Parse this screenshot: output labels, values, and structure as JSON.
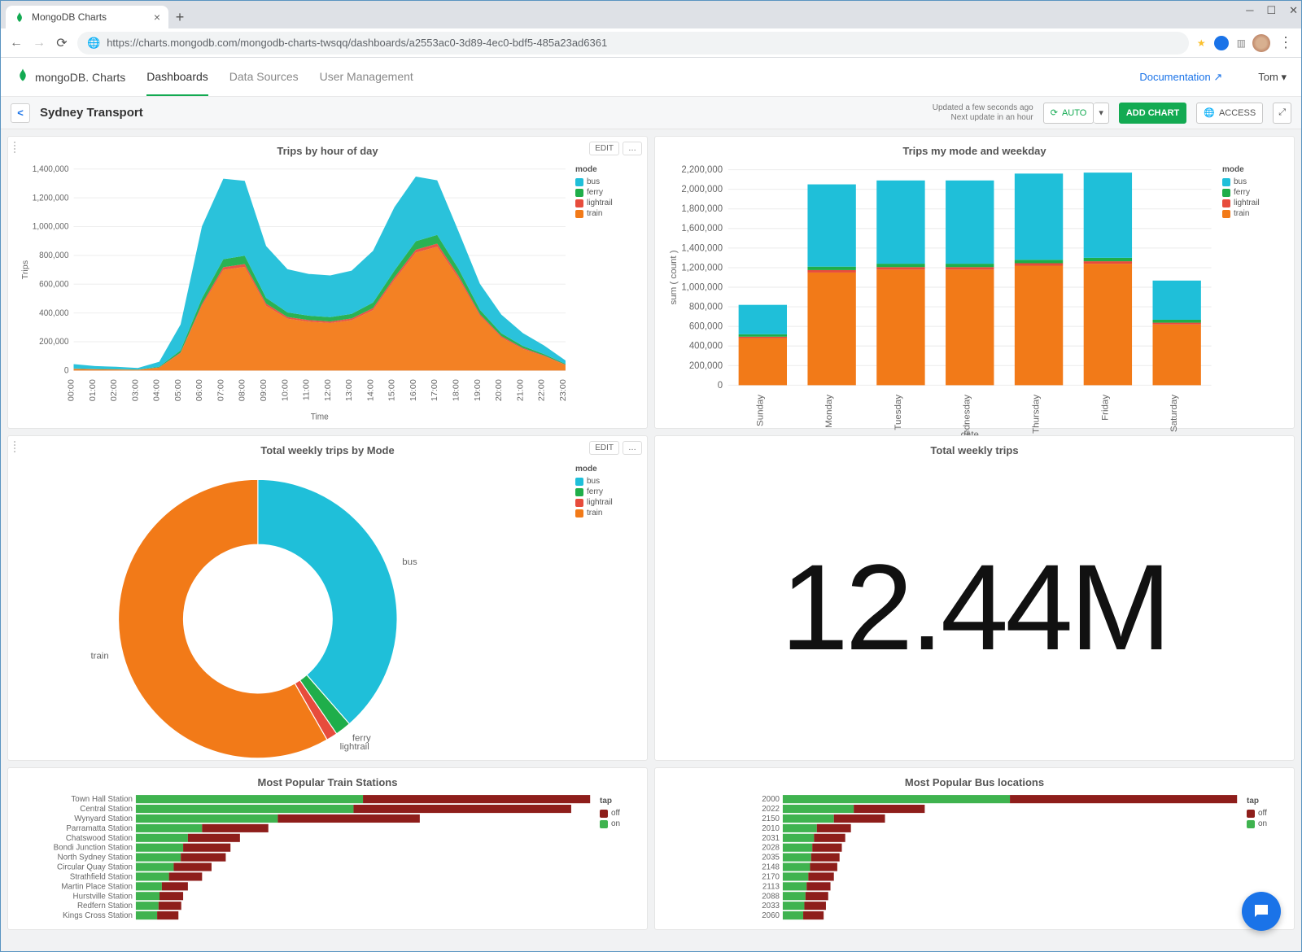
{
  "browser": {
    "tab_title": "MongoDB Charts",
    "url": "https://charts.mongodb.com/mongodb-charts-twsqq/dashboards/a2553ac0-3d89-4ec0-bdf5-485a23ad6361"
  },
  "appbar": {
    "brand_main": "mongoDB",
    "brand_sub": "Charts",
    "nav": {
      "dashboards": "Dashboards",
      "datasources": "Data Sources",
      "usermgmt": "User Management"
    },
    "documentation": "Documentation",
    "user": "Tom"
  },
  "dashbar": {
    "title": "Sydney Transport",
    "status1": "Updated a few seconds ago",
    "status2": "Next update in an hour",
    "auto": "AUTO",
    "add": "ADD CHART",
    "access": "ACCESS"
  },
  "cards": {
    "area": {
      "title": "Trips by hour of day",
      "edit": "EDIT",
      "xlabel": "Time",
      "ylabel": "Trips"
    },
    "bars": {
      "title": "Trips my mode and weekday",
      "xlabel": "date",
      "ylabel": "sum ( count )"
    },
    "donut": {
      "title": "Total weekly trips by Mode",
      "edit": "EDIT"
    },
    "kpi": {
      "title": "Total weekly trips",
      "value": "12.44M"
    },
    "train": {
      "title": "Most Popular Train Stations"
    },
    "buses": {
      "title": "Most Popular Bus locations"
    }
  },
  "legend": {
    "mode": "mode",
    "bus": "bus",
    "ferry": "ferry",
    "light": "lightrail",
    "train": "train",
    "tap": "tap",
    "off": "off",
    "on": "on"
  },
  "chart_data": [
    {
      "id": "trips_by_hour",
      "type": "area",
      "title": "Trips by hour of day",
      "xlabel": "Time",
      "ylabel": "Trips",
      "x": [
        "00:00",
        "01:00",
        "02:00",
        "03:00",
        "04:00",
        "05:00",
        "06:00",
        "07:00",
        "08:00",
        "09:00",
        "10:00",
        "11:00",
        "12:00",
        "13:00",
        "14:00",
        "15:00",
        "16:00",
        "17:00",
        "18:00",
        "19:00",
        "20:00",
        "21:00",
        "22:00",
        "23:00"
      ],
      "ylim": [
        0,
        1400000
      ],
      "series": [
        {
          "name": "train",
          "color": "#f27a18",
          "values": [
            10000,
            8000,
            7000,
            5000,
            20000,
            120000,
            450000,
            700000,
            720000,
            450000,
            360000,
            340000,
            330000,
            350000,
            420000,
            630000,
            820000,
            860000,
            640000,
            380000,
            230000,
            150000,
            100000,
            38000
          ]
        },
        {
          "name": "lightrail",
          "color": "#e74c3c",
          "values": [
            2000,
            1500,
            1200,
            1000,
            2000,
            5000,
            12000,
            18000,
            20000,
            15000,
            12000,
            11000,
            11000,
            12000,
            14000,
            17000,
            20000,
            22000,
            18000,
            12000,
            9000,
            7000,
            5000,
            3000
          ]
        },
        {
          "name": "ferry",
          "color": "#1fae4a",
          "values": [
            3000,
            2000,
            2000,
            1500,
            4000,
            15000,
            40000,
            55000,
            58000,
            40000,
            32000,
            30000,
            30000,
            32000,
            38000,
            48000,
            58000,
            60000,
            48000,
            30000,
            20000,
            14000,
            9000,
            5000
          ]
        },
        {
          "name": "bus",
          "color": "#1fbfd9",
          "values": [
            30000,
            20000,
            16000,
            10000,
            35000,
            180000,
            500000,
            560000,
            520000,
            360000,
            300000,
            290000,
            290000,
            300000,
            360000,
            440000,
            450000,
            380000,
            260000,
            180000,
            130000,
            90000,
            60000,
            24000
          ]
        }
      ]
    },
    {
      "id": "trips_by_weekday",
      "type": "bar",
      "stacked": true,
      "title": "Trips my mode and weekday",
      "xlabel": "date",
      "ylabel": "sum ( count )",
      "categories": [
        "Sunday",
        "Monday",
        "Tuesday",
        "Wednesday",
        "Thursday",
        "Friday",
        "Saturday"
      ],
      "ylim": [
        0,
        2200000
      ],
      "series": [
        {
          "name": "train",
          "color": "#f27a18",
          "values": [
            480000,
            1150000,
            1180000,
            1180000,
            1220000,
            1240000,
            620000
          ]
        },
        {
          "name": "lightrail",
          "color": "#e74c3c",
          "values": [
            15000,
            25000,
            25000,
            25000,
            25000,
            25000,
            18000
          ]
        },
        {
          "name": "ferry",
          "color": "#1fae4a",
          "values": [
            25000,
            35000,
            35000,
            35000,
            35000,
            35000,
            30000
          ]
        },
        {
          "name": "bus",
          "color": "#1fbfd9",
          "values": [
            300000,
            840000,
            850000,
            850000,
            880000,
            870000,
            400000
          ]
        }
      ]
    },
    {
      "id": "weekly_by_mode",
      "type": "pie",
      "title": "Total weekly trips by Mode",
      "slices": [
        {
          "name": "bus",
          "color": "#1fbfd9",
          "value": 4800000
        },
        {
          "name": "ferry",
          "color": "#1fae4a",
          "value": 230000
        },
        {
          "name": "lightrail",
          "color": "#e74c3c",
          "value": 160000
        },
        {
          "name": "train",
          "color": "#f27a18",
          "value": 7250000
        }
      ]
    },
    {
      "id": "weekly_total",
      "type": "number",
      "title": "Total weekly trips",
      "value": "12.44M"
    },
    {
      "id": "train_stations",
      "type": "bar",
      "orientation": "h",
      "stacked": true,
      "title": "Most Popular Train Stations",
      "categories": [
        "Town Hall Station",
        "Central Station",
        "Wynyard Station",
        "Parramatta Station",
        "Chatswood Station",
        "Bondi Junction Station",
        "North Sydney Station",
        "Circular Quay Station",
        "Strathfield Station",
        "Martin Place Station",
        "Hurstville Station",
        "Redfern Station",
        "Kings Cross Station"
      ],
      "series": [
        {
          "name": "on",
          "color": "#3fb34f",
          "values": [
            480,
            460,
            300,
            140,
            110,
            100,
            95,
            80,
            70,
            55,
            50,
            48,
            45
          ]
        },
        {
          "name": "off",
          "color": "#8e1e1b",
          "values": [
            480,
            460,
            300,
            140,
            110,
            100,
            95,
            80,
            70,
            55,
            50,
            48,
            45
          ]
        }
      ]
    },
    {
      "id": "bus_locations",
      "type": "bar",
      "orientation": "h",
      "stacked": true,
      "title": "Most Popular Bus locations",
      "categories": [
        "2000",
        "2022",
        "2150",
        "2010",
        "2031",
        "2028",
        "2035",
        "2148",
        "2170",
        "2113",
        "2088",
        "2033",
        "2060"
      ],
      "series": [
        {
          "name": "on",
          "color": "#3fb34f",
          "values": [
            400,
            125,
            90,
            60,
            55,
            52,
            50,
            48,
            45,
            42,
            40,
            38,
            36
          ]
        },
        {
          "name": "off",
          "color": "#8e1e1b",
          "values": [
            400,
            125,
            90,
            60,
            55,
            52,
            50,
            48,
            45,
            42,
            40,
            38,
            36
          ]
        }
      ]
    }
  ]
}
